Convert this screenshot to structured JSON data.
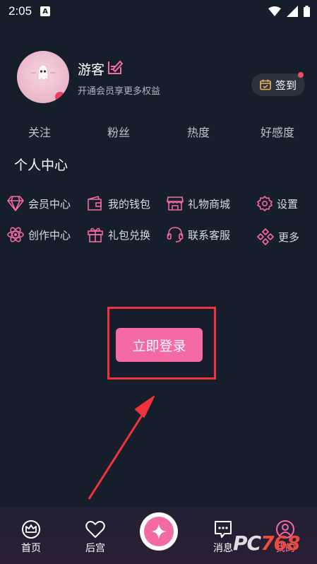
{
  "status_bar": {
    "time": "2:05",
    "a_badge": "A"
  },
  "profile": {
    "username": "游客",
    "subtitle": "开通会员享更多权益",
    "signin_label": "签到"
  },
  "stats": [
    "关注",
    "粉丝",
    "热度",
    "好感度"
  ],
  "section_title": "个人中心",
  "menu": {
    "vip_center": "会员中心",
    "wallet": "我的钱包",
    "gift_mall": "礼物商城",
    "settings": "设置",
    "creation_center": "创作中心",
    "gift_redeem": "礼包兑换",
    "customer_service": "联系客服",
    "more": "更多"
  },
  "login_button": "立即登录",
  "bottom_nav": {
    "home": "首页",
    "harem": "后宫",
    "messages": "消息",
    "mine": "我的"
  },
  "watermark": {
    "prefix": "PC",
    "number": "768"
  },
  "colors": {
    "background": "#171e2b",
    "accent": "#f36aa5",
    "highlight_box": "#f0323c"
  }
}
